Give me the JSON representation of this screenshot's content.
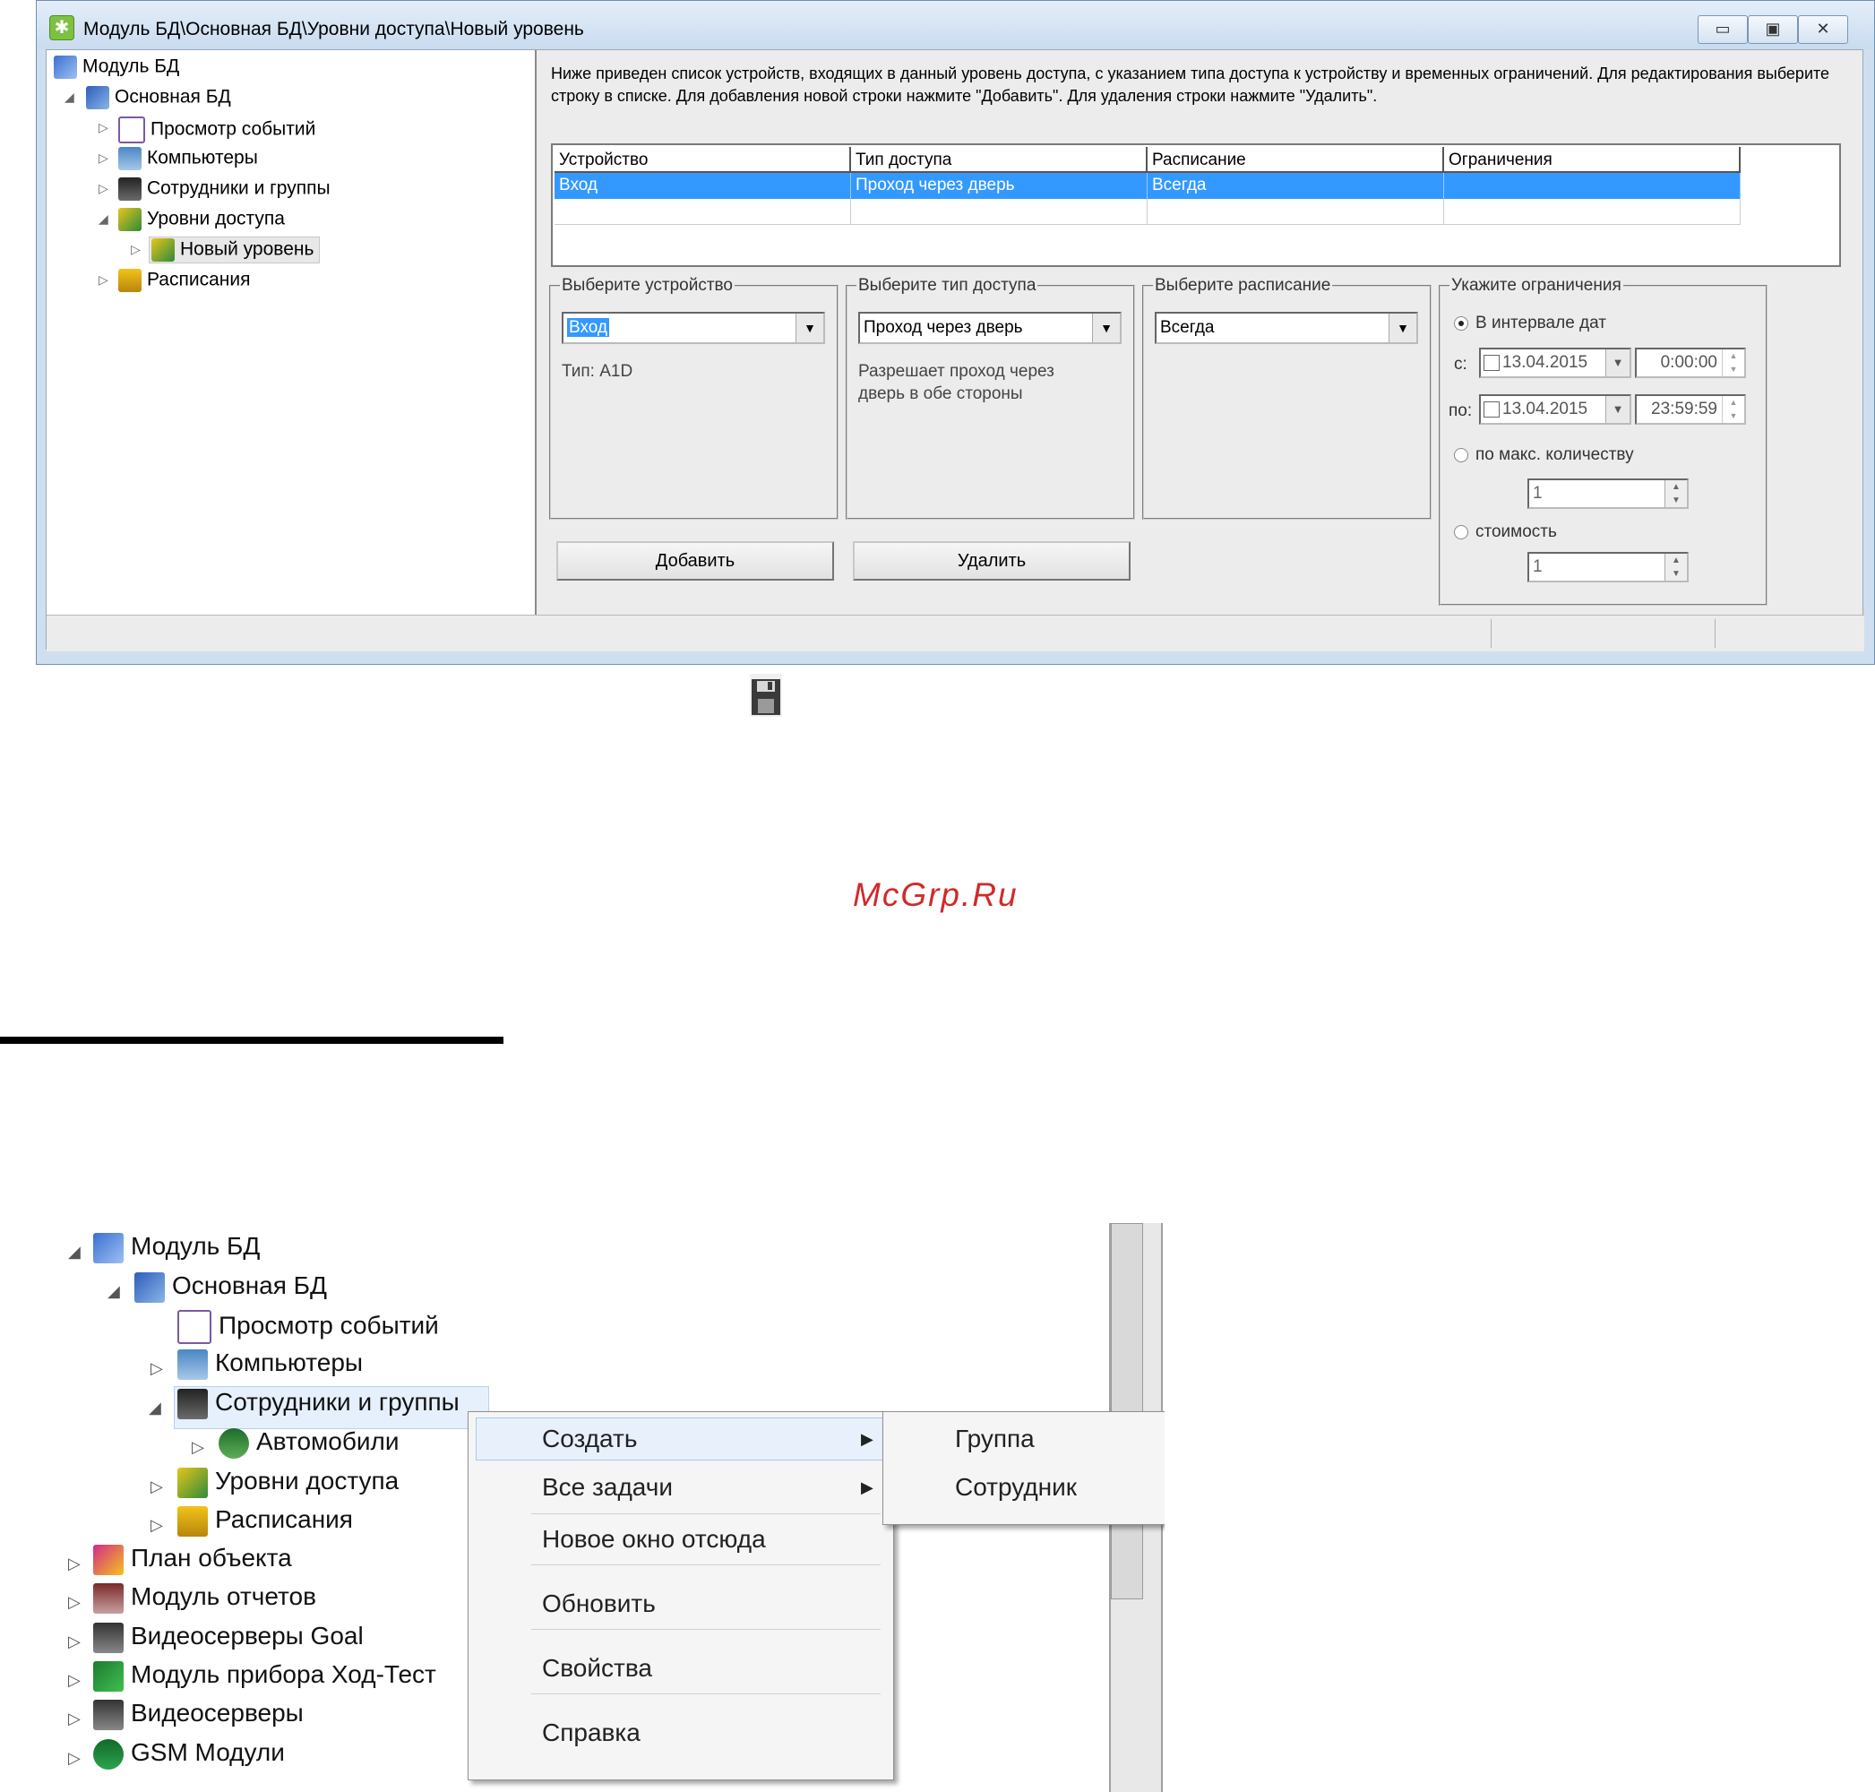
{
  "window1": {
    "title": "Модуль БД\\Основная БД\\Уровни доступа\\Новый уровень",
    "controls": {
      "minimize": "▭",
      "maximize": "▣",
      "close": "✕"
    },
    "tree": [
      {
        "label": "Модуль БД",
        "icon": "db-module-icon"
      },
      {
        "label": "Основная БД",
        "icon": "database-icon"
      },
      {
        "label": "Просмотр событий",
        "icon": "event-log-icon"
      },
      {
        "label": "Компьютеры",
        "icon": "computers-icon"
      },
      {
        "label": "Сотрудники и группы",
        "icon": "employees-icon"
      },
      {
        "label": "Уровни доступа",
        "icon": "access-levels-icon"
      },
      {
        "label": "Новый уровень",
        "icon": "access-level-icon"
      },
      {
        "label": "Расписания",
        "icon": "schedules-icon"
      }
    ],
    "description": "Ниже приведен список устройств, входящих в данный уровень доступа, с указанием типа доступа к устройству и временных ограничений. Для редактирования выберите строку в списке. Для добавления новой строки нажмите \"Добавить\". Для удаления строки нажмите \"Удалить\".",
    "grid": {
      "columns": [
        "Устройство",
        "Тип доступа",
        "Расписание",
        "Ограничения"
      ],
      "rows": [
        [
          "Вход",
          "Проход через дверь",
          "Всегда",
          ""
        ]
      ]
    },
    "device_group": {
      "legend": "Выберите устройство",
      "value": "Вход",
      "type_note": "Тип: A1D"
    },
    "access_group": {
      "legend": "Выберите тип доступа",
      "value": "Проход через дверь",
      "note": "Разрешает проход через дверь в обе стороны"
    },
    "schedule_group": {
      "legend": "Выберите расписание",
      "value": "Всегда"
    },
    "limits_group": {
      "legend": "Укажите ограничения",
      "option_interval": "В интервале дат",
      "from_label": "с:",
      "from_date": "13.04.2015",
      "from_time": "0:00:00",
      "to_label": "по:",
      "to_date": "13.04.2015",
      "to_time": "23:59:59",
      "option_max": "по макс. количеству",
      "max_value": "1",
      "option_cost": "стоимость",
      "cost_value": "1"
    },
    "buttons": {
      "add": "Добавить",
      "delete": "Удалить"
    }
  },
  "watermark": "McGrp.Ru",
  "window2": {
    "tree": [
      {
        "label": "Модуль БД",
        "icon": "db-module-icon"
      },
      {
        "label": "Основная БД",
        "icon": "database-icon"
      },
      {
        "label": "Просмотр событий",
        "icon": "event-log-icon"
      },
      {
        "label": "Компьютеры",
        "icon": "computers-icon"
      },
      {
        "label": "Сотрудники и группы",
        "icon": "employees-icon"
      },
      {
        "label": "Автомобили",
        "icon": "cars-icon"
      },
      {
        "label": "Уровни доступа",
        "icon": "access-levels-icon"
      },
      {
        "label": "Расписания",
        "icon": "schedules-icon"
      },
      {
        "label": "План объекта",
        "icon": "floor-plan-icon"
      },
      {
        "label": "Модуль отчетов",
        "icon": "reports-icon"
      },
      {
        "label": "Видеосерверы Goal",
        "icon": "video-server-icon"
      },
      {
        "label": "Модуль прибора Ход-Тест",
        "icon": "device-module-icon"
      },
      {
        "label": "Видеосерверы",
        "icon": "video-server-icon"
      },
      {
        "label": "GSM Модули",
        "icon": "gsm-icon"
      }
    ],
    "context_menu": [
      "Создать",
      "Все задачи",
      "Новое окно отсюда",
      "Обновить",
      "Свойства",
      "Справка"
    ],
    "submenu": [
      "Группа",
      "Сотрудник"
    ],
    "submenu_arrow": "▶"
  }
}
